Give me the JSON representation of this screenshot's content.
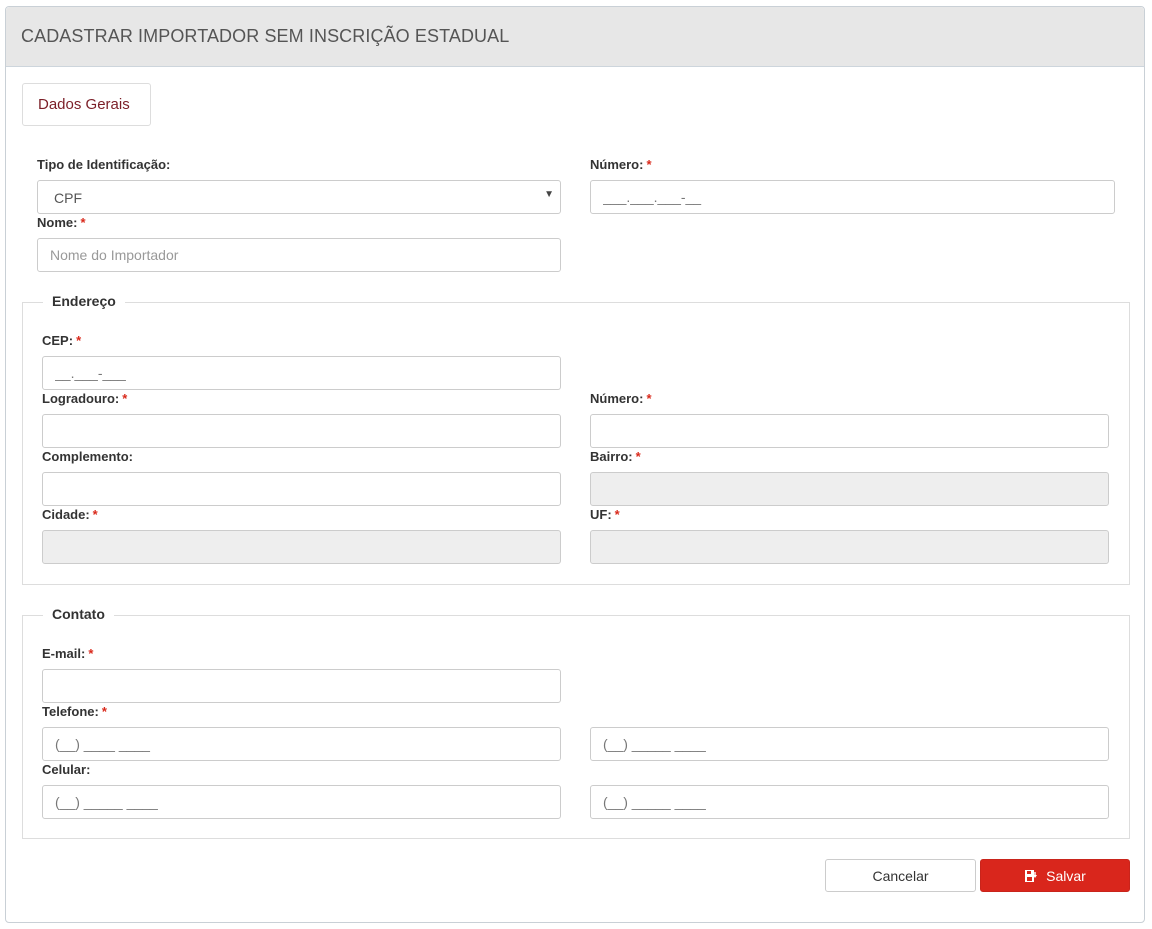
{
  "header": {
    "title": "CADASTRAR IMPORTADOR SEM INSCRIÇÃO ESTADUAL"
  },
  "tabs": [
    {
      "label": "Dados Gerais"
    }
  ],
  "required_marker": "*",
  "general": {
    "tipo_label": "Tipo de Identificação:",
    "tipo_value": "CPF",
    "numero_label": "Número:",
    "numero_value": "___.___.___-__",
    "nome_label": "Nome:",
    "nome_placeholder": "Nome do Importador"
  },
  "endereco": {
    "legend": "Endereço",
    "cep_label": "CEP:",
    "cep_value": "__.___-___",
    "logradouro_label": "Logradouro:",
    "numero_label": "Número:",
    "complemento_label": "Complemento:",
    "bairro_label": "Bairro:",
    "cidade_label": "Cidade:",
    "uf_label": "UF:"
  },
  "contato": {
    "legend": "Contato",
    "email_label": "E-mail:",
    "telefone_label": "Telefone:",
    "telefone_value": "(__) ____ ____",
    "telefone2_value": "(__) _____ ____",
    "celular_label": "Celular:",
    "celular_value": "(__) _____ ____",
    "celular2_value": "(__) _____ ____"
  },
  "actions": {
    "cancel_label": "Cancelar",
    "save_label": "Salvar"
  },
  "colors": {
    "accent": "#d9261c",
    "tab_text": "#7b1e27",
    "required": "#d9281a"
  }
}
